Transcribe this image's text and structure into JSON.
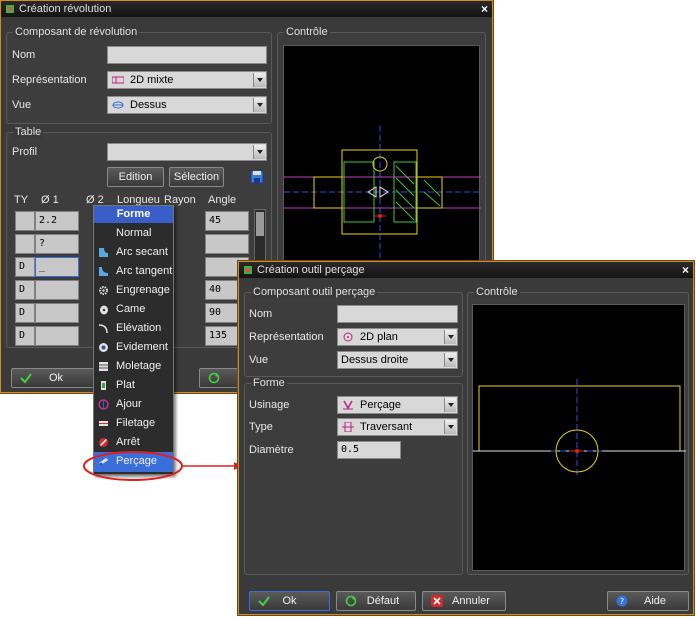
{
  "window1": {
    "title": "Création révolution",
    "composant": {
      "title": "Composant de révolution",
      "nom_label": "Nom",
      "nom_value": "",
      "representation_label": "Représentation",
      "representation_value": "2D mixte",
      "vue_label": "Vue",
      "vue_value": "Dessus"
    },
    "controle_title": "Contrôle",
    "table": {
      "title": "Table",
      "profil_label": "Profil",
      "profil_value": "",
      "edition_label": "Edition",
      "selection_label": "Sélection",
      "columns": [
        "TY",
        "Ø 1",
        "Ø 2",
        "Longueu",
        "Rayon",
        "Angle"
      ],
      "rows": [
        {
          "ty": "",
          "d1": "2.2",
          "angle": "45"
        },
        {
          "ty": "",
          "d1": "?",
          "angle": ""
        },
        {
          "ty": "D",
          "d1": "_",
          "angle": ""
        },
        {
          "ty": "D",
          "d1": "",
          "angle": "40"
        },
        {
          "ty": "D",
          "d1": "",
          "angle": "90"
        },
        {
          "ty": "D",
          "d1": "",
          "angle": "135"
        }
      ]
    },
    "ok_label": "Ok"
  },
  "menu": {
    "header": "Forme",
    "items": [
      {
        "label": "Normal",
        "icon": "normal-icon"
      },
      {
        "label": "Arc secant",
        "icon": "arc-secant-icon"
      },
      {
        "label": "Arc tangent",
        "icon": "arc-tangent-icon"
      },
      {
        "label": "Engrenage",
        "icon": "gear-icon"
      },
      {
        "label": "Came",
        "icon": "cam-icon"
      },
      {
        "label": "Elévation",
        "icon": "elevation-icon"
      },
      {
        "label": "Evidement",
        "icon": "recess-icon"
      },
      {
        "label": "Moletage",
        "icon": "knurl-icon"
      },
      {
        "label": "Plat",
        "icon": "flat-icon"
      },
      {
        "label": "Ajour",
        "icon": "opening-icon"
      },
      {
        "label": "Filetage",
        "icon": "thread-icon"
      },
      {
        "label": "Arrêt",
        "icon": "stop-icon"
      },
      {
        "label": "Perçage",
        "icon": "drill-icon"
      }
    ],
    "selected": "Perçage"
  },
  "window2": {
    "title": "Création outil perçage",
    "composant": {
      "title": "Composant outil perçage",
      "nom_label": "Nom",
      "nom_value": "",
      "representation_label": "Représentation",
      "representation_value": "2D plan",
      "vue_label": "Vue",
      "vue_value": "Dessus droite"
    },
    "controle_title": "Contrôle",
    "forme": {
      "title": "Forme",
      "usinage_label": "Usinage",
      "usinage_value": "Perçage",
      "type_label": "Type",
      "type_value": "Traversant",
      "diametre_label": "Diamètre",
      "diametre_value": "0.5"
    },
    "ok_label": "Ok",
    "defaut_label": "Défaut",
    "annuler_label": "Annuler",
    "aide_label": "Aide"
  },
  "colors": {
    "window_border": "#d08a2a",
    "menu_highlight": "#3a6ed8",
    "callout": "#e02020",
    "drawing_yellow": "#e8d21a",
    "drawing_green": "#3cc83c",
    "axis_blue": "#3050e0",
    "axis_red": "#e02020"
  }
}
